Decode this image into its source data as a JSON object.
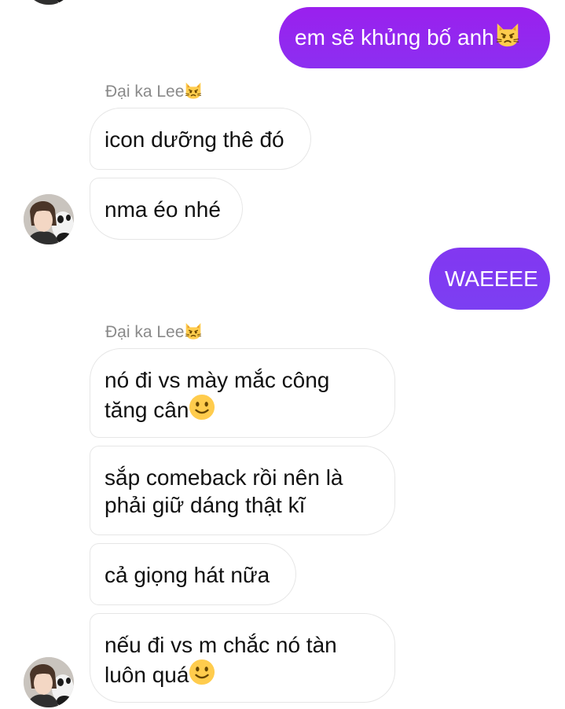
{
  "conversation": {
    "sender_name": "Đại ka Lee",
    "sender_emoji": "pouting-cat-emoji",
    "messages": [
      {
        "from": "me",
        "text": "em sẽ khủng bố anh",
        "emoji": "pouting-cat-emoji"
      },
      {
        "from": "them",
        "text": "icon dưỡng thê đó"
      },
      {
        "from": "them",
        "text": "nma éo nhé"
      },
      {
        "from": "me",
        "text": "WAEEEE"
      },
      {
        "from": "them",
        "line1": "nó đi vs mày mắc công",
        "line2": "tăng cân",
        "emoji": "slightly-smiling-face-emoji"
      },
      {
        "from": "them",
        "line1": "sắp comeback rồi nên là",
        "line2": "phải giữ dáng thật kĩ"
      },
      {
        "from": "them",
        "text": "cả giọng hát nữa"
      },
      {
        "from": "them",
        "line1": "nếu đi vs m chắc nó tàn",
        "line2": "luôn quá",
        "emoji": "slightly-smiling-face-emoji"
      }
    ]
  },
  "colors": {
    "outgoing_gradient_top": "#9b22ee",
    "outgoing_gradient_bottom": "#7b3ff2",
    "incoming_border": "#e6e6e6",
    "sender_label": "#8a8a8a",
    "emoji_yellow": "#ffcc4d"
  }
}
